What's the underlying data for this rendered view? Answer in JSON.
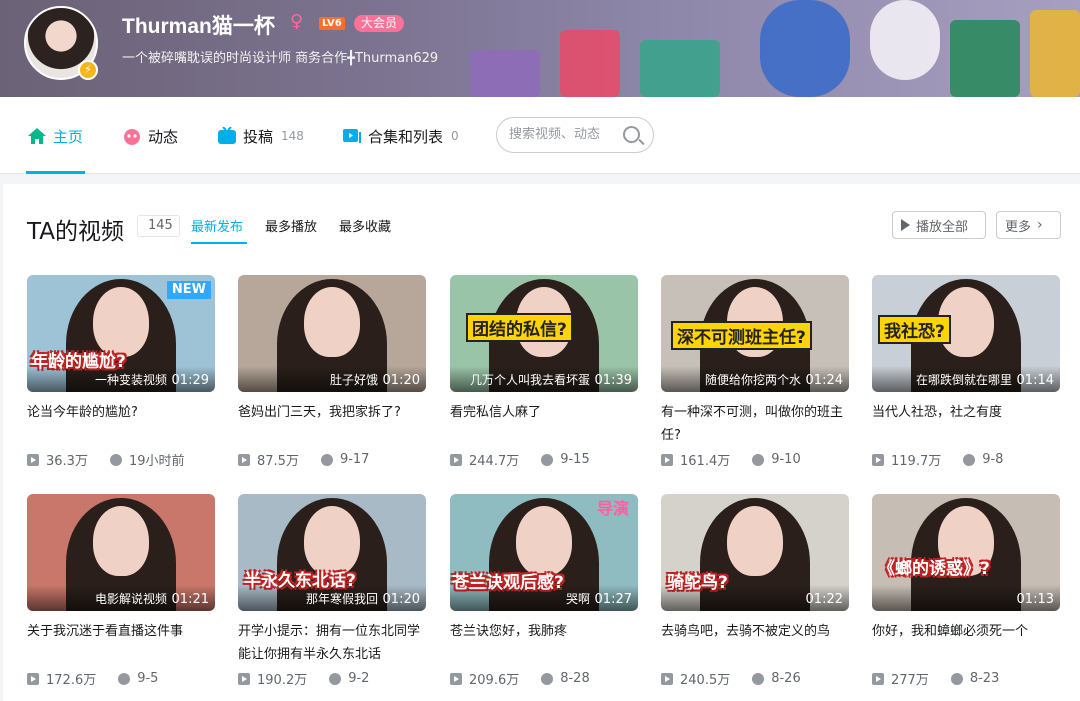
{
  "header": {
    "username": "Thurman猫一杯",
    "gender_symbol": "♀",
    "level": "LV6",
    "vip_badge": "大会员",
    "signature": "一个被碎嘴耽误的时尚设计师 商务合作╋Thurman629",
    "avatar_badge": "⚡"
  },
  "nav": {
    "tabs": [
      {
        "label": "主页",
        "count": ""
      },
      {
        "label": "动态",
        "count": ""
      },
      {
        "label": "投稿",
        "count": "148"
      },
      {
        "label": "合集和列表",
        "count": "0"
      }
    ],
    "search_placeholder": "搜索视频、动态"
  },
  "section": {
    "title": "TA的视频",
    "count": "145",
    "sort_tabs": [
      "最新发布",
      "最多播放",
      "最多收藏"
    ],
    "play_all": "播放全部",
    "more": "更多"
  },
  "videos": [
    {
      "caption": "年龄的尴尬?",
      "subtitle": "一种变装视频",
      "tag": "NEW",
      "duration": "01:29",
      "title": "论当今年龄的尴尬?",
      "views": "36.3万",
      "date": "19小时前",
      "bg": "#9fc3d6"
    },
    {
      "caption": "",
      "subtitle": "肚子好饿",
      "tag": "",
      "duration": "01:20",
      "title": "爸妈出门三天，我把家拆了?",
      "views": "87.5万",
      "date": "9-17",
      "bg": "#b7a79a"
    },
    {
      "caption": "团结的私信?",
      "subtitle": "几万个人叫我去看坏蛋",
      "tag": "",
      "duration": "01:39",
      "title": "看完私信人麻了",
      "views": "244.7万",
      "date": "9-15",
      "bg": "#9ac4a8"
    },
    {
      "caption": "深不可测班主任?",
      "subtitle": "随便给你挖两个水",
      "tag": "",
      "duration": "01:24",
      "title": "有一种深不可测，叫做你的班主任?",
      "views": "161.4万",
      "date": "9-10",
      "bg": "#c7c0b8"
    },
    {
      "caption": "我社恐?",
      "subtitle": "在哪跌倒就在哪里",
      "tag": "",
      "duration": "01:14",
      "title": "当代人社恐，社之有度",
      "views": "119.7万",
      "date": "9-8",
      "bg": "#c9cfd6"
    },
    {
      "caption": "",
      "subtitle": "电影解说视频",
      "tag": "",
      "duration": "01:21",
      "title": "关于我沉迷于看直播这件事",
      "views": "172.6万",
      "date": "9-5",
      "bg": "#c9776a"
    },
    {
      "caption": "半永久东北话?",
      "subtitle": "那年寒假我回",
      "tag": "",
      "duration": "01:20",
      "title": "开学小提示：拥有一位东北同学能让你拥有半永久东北话",
      "views": "190.2万",
      "date": "9-2",
      "bg": "#a9bac7"
    },
    {
      "caption": "苍兰诀观后感?",
      "subtitle": "哭啊",
      "tag": "导演",
      "duration": "01:27",
      "title": "苍兰诀您好，我肺疼",
      "views": "209.6万",
      "date": "8-28",
      "bg": "#8fbcc0"
    },
    {
      "caption": "骑鸵鸟?",
      "subtitle": "",
      "tag": "",
      "duration": "01:22",
      "title": "去骑鸟吧，去骑不被定义的鸟",
      "views": "240.5万",
      "date": "8-26",
      "bg": "#d5d2cc"
    },
    {
      "caption": "《螂的诱惑》?",
      "subtitle": "",
      "tag": "",
      "duration": "01:13",
      "title": "你好，我和蟑螂必须死一个",
      "views": "277万",
      "date": "8-23",
      "bg": "#c6bdb4"
    }
  ]
}
